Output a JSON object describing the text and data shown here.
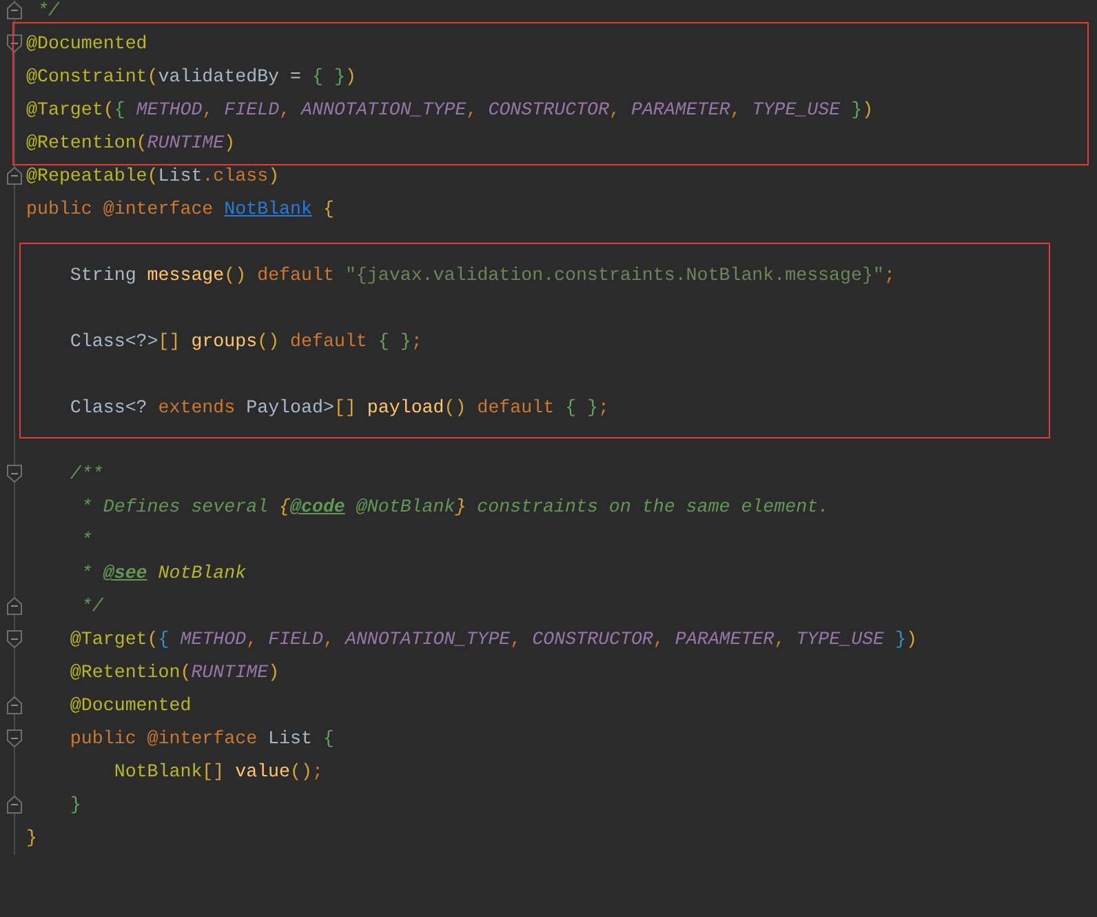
{
  "editor": {
    "lines": [
      {
        "kind": "code",
        "fold_end": true,
        "tokens": [
          {
            "text": " */",
            "kind": "comment"
          }
        ]
      },
      {
        "kind": "code",
        "fold_start": true,
        "highlighted": true,
        "tokens": [
          {
            "text": "@Documented",
            "kind": "annotation"
          }
        ]
      },
      {
        "kind": "code",
        "highlighted": true,
        "tokens": [
          {
            "text": "@Constraint",
            "kind": "annotation"
          },
          {
            "text": "(",
            "kind": "bracket_gold"
          },
          {
            "text": "validatedBy = ",
            "kind": "plain"
          },
          {
            "text": "{ }",
            "kind": "bracket_green"
          },
          {
            "text": ")",
            "kind": "bracket_gold"
          }
        ]
      },
      {
        "kind": "code",
        "highlighted": true,
        "tokens": [
          {
            "text": "@Target",
            "kind": "annotation"
          },
          {
            "text": "(",
            "kind": "bracket_gold"
          },
          {
            "text": "{ ",
            "kind": "bracket_green"
          },
          {
            "text": "METHOD",
            "kind": "constant"
          },
          {
            "text": ", ",
            "kind": "separator"
          },
          {
            "text": "FIELD",
            "kind": "constant"
          },
          {
            "text": ", ",
            "kind": "separator"
          },
          {
            "text": "ANNOTATION_TYPE",
            "kind": "constant"
          },
          {
            "text": ", ",
            "kind": "separator"
          },
          {
            "text": "CONSTRUCTOR",
            "kind": "constant"
          },
          {
            "text": ", ",
            "kind": "separator"
          },
          {
            "text": "PARAMETER",
            "kind": "constant"
          },
          {
            "text": ", ",
            "kind": "separator"
          },
          {
            "text": "TYPE_USE",
            "kind": "constant"
          },
          {
            "text": " }",
            "kind": "bracket_green"
          },
          {
            "text": ")",
            "kind": "bracket_gold"
          }
        ]
      },
      {
        "kind": "code",
        "highlighted": true,
        "tokens": [
          {
            "text": "@Retention",
            "kind": "annotation"
          },
          {
            "text": "(",
            "kind": "bracket_gold"
          },
          {
            "text": "RUNTIME",
            "kind": "constant"
          },
          {
            "text": ")",
            "kind": "bracket_gold"
          }
        ]
      },
      {
        "kind": "code",
        "fold_end": true,
        "tokens": [
          {
            "text": "@Repeatable",
            "kind": "annotation"
          },
          {
            "text": "(",
            "kind": "bracket_gold"
          },
          {
            "text": "List",
            "kind": "plain"
          },
          {
            "text": ".",
            "kind": "separator"
          },
          {
            "text": "class",
            "kind": "keyword"
          },
          {
            "text": ")",
            "kind": "bracket_gold"
          }
        ]
      },
      {
        "kind": "code",
        "tokens": [
          {
            "text": "public @interface ",
            "kind": "keyword"
          },
          {
            "text": "NotBlank",
            "kind": "link"
          },
          {
            "text": " {",
            "kind": "bracket_gold"
          }
        ]
      },
      {
        "kind": "blank"
      },
      {
        "kind": "code",
        "highlighted": true,
        "tokens": [
          {
            "text": "    String ",
            "kind": "plain"
          },
          {
            "text": "message",
            "kind": "method"
          },
          {
            "text": "()",
            "kind": "bracket_gold"
          },
          {
            "text": " default ",
            "kind": "keyword"
          },
          {
            "text": "\"{javax.validation.constraints.NotBlank.message}\"",
            "kind": "string"
          },
          {
            "text": ";",
            "kind": "separator"
          }
        ]
      },
      {
        "kind": "blank",
        "highlighted": true
      },
      {
        "kind": "code",
        "highlighted": true,
        "tokens": [
          {
            "text": "    Class<?>",
            "kind": "plain"
          },
          {
            "text": "[]",
            "kind": "bracket_gold"
          },
          {
            "text": " groups",
            "kind": "method"
          },
          {
            "text": "()",
            "kind": "bracket_gold"
          },
          {
            "text": " default ",
            "kind": "keyword"
          },
          {
            "text": "{ }",
            "kind": "bracket_green"
          },
          {
            "text": ";",
            "kind": "separator"
          }
        ]
      },
      {
        "kind": "blank",
        "highlighted": true
      },
      {
        "kind": "code",
        "highlighted": true,
        "tokens": [
          {
            "text": "    Class<? ",
            "kind": "plain"
          },
          {
            "text": "extends",
            "kind": "keyword"
          },
          {
            "text": " Payload>",
            "kind": "plain"
          },
          {
            "text": "[]",
            "kind": "bracket_gold"
          },
          {
            "text": " payload",
            "kind": "method"
          },
          {
            "text": "()",
            "kind": "bracket_gold"
          },
          {
            "text": " default ",
            "kind": "keyword"
          },
          {
            "text": "{ }",
            "kind": "bracket_green"
          },
          {
            "text": ";",
            "kind": "separator"
          }
        ]
      },
      {
        "kind": "blank"
      },
      {
        "kind": "code",
        "fold_start": true,
        "tokens": [
          {
            "text": "    /**",
            "kind": "comment"
          }
        ]
      },
      {
        "kind": "code",
        "tokens": [
          {
            "text": "     * Defines several ",
            "kind": "comment"
          },
          {
            "text": "{",
            "kind": "doc_brace"
          },
          {
            "text": "@code",
            "kind": "doc_tag"
          },
          {
            "text": " @NotBlank",
            "kind": "comment"
          },
          {
            "text": "}",
            "kind": "doc_brace"
          },
          {
            "text": " constraints on the same element.",
            "kind": "comment"
          }
        ]
      },
      {
        "kind": "code",
        "tokens": [
          {
            "text": "     *",
            "kind": "comment"
          }
        ]
      },
      {
        "kind": "code",
        "tokens": [
          {
            "text": "     * ",
            "kind": "comment"
          },
          {
            "text": "@see",
            "kind": "doc_tag"
          },
          {
            "text": " NotBlank",
            "kind": "doc_ref"
          }
        ]
      },
      {
        "kind": "code",
        "fold_end": true,
        "tokens": [
          {
            "text": "     */",
            "kind": "comment"
          }
        ]
      },
      {
        "kind": "code",
        "fold_start": true,
        "tokens": [
          {
            "text": "    @Target",
            "kind": "annotation"
          },
          {
            "text": "(",
            "kind": "bracket_gold"
          },
          {
            "text": "{ ",
            "kind": "bracket_blue"
          },
          {
            "text": "METHOD",
            "kind": "constant"
          },
          {
            "text": ", ",
            "kind": "separator"
          },
          {
            "text": "FIELD",
            "kind": "constant"
          },
          {
            "text": ", ",
            "kind": "separator"
          },
          {
            "text": "ANNOTATION_TYPE",
            "kind": "constant"
          },
          {
            "text": ", ",
            "kind": "separator"
          },
          {
            "text": "CONSTRUCTOR",
            "kind": "constant"
          },
          {
            "text": ", ",
            "kind": "separator"
          },
          {
            "text": "PARAMETER",
            "kind": "constant"
          },
          {
            "text": ", ",
            "kind": "separator"
          },
          {
            "text": "TYPE_USE",
            "kind": "constant"
          },
          {
            "text": " }",
            "kind": "bracket_blue"
          },
          {
            "text": ")",
            "kind": "bracket_gold"
          }
        ]
      },
      {
        "kind": "code",
        "tokens": [
          {
            "text": "    @Retention",
            "kind": "annotation"
          },
          {
            "text": "(",
            "kind": "bracket_gold"
          },
          {
            "text": "RUNTIME",
            "kind": "constant"
          },
          {
            "text": ")",
            "kind": "bracket_gold"
          }
        ]
      },
      {
        "kind": "code",
        "fold_end": true,
        "tokens": [
          {
            "text": "    @Documented",
            "kind": "annotation"
          }
        ]
      },
      {
        "kind": "code",
        "fold_start": true,
        "tokens": [
          {
            "text": "    public @interface",
            "kind": "keyword"
          },
          {
            "text": " List ",
            "kind": "plain"
          },
          {
            "text": "{",
            "kind": "bracket_green"
          }
        ]
      },
      {
        "kind": "code",
        "tokens": [
          {
            "text": "        NotBlank",
            "kind": "type_ref"
          },
          {
            "text": "[]",
            "kind": "bracket_gold"
          },
          {
            "text": " value",
            "kind": "method"
          },
          {
            "text": "()",
            "kind": "bracket_gold"
          },
          {
            "text": ";",
            "kind": "separator"
          }
        ]
      },
      {
        "kind": "code",
        "fold_end": true,
        "tokens": [
          {
            "text": "    }",
            "kind": "bracket_green"
          }
        ]
      },
      {
        "kind": "code",
        "tokens": [
          {
            "text": "}",
            "kind": "bracket_gold"
          }
        ]
      }
    ]
  }
}
